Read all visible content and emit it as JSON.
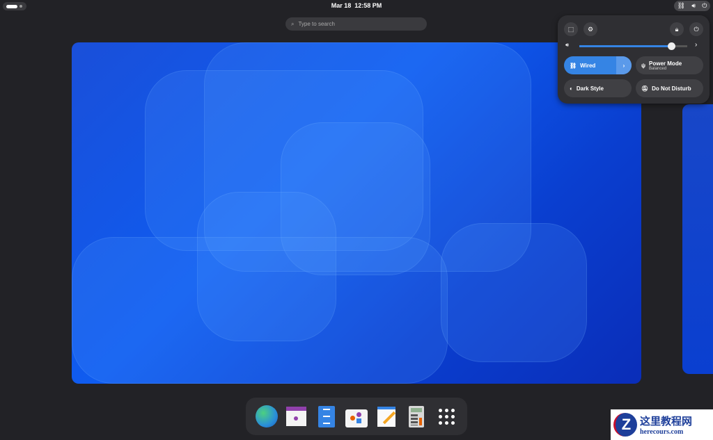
{
  "topbar": {
    "date": "Mar 18",
    "time": "12:58 PM"
  },
  "search": {
    "placeholder": "Type to search"
  },
  "quick_settings": {
    "tiles": [
      {
        "label": "Wired",
        "active": true
      },
      {
        "label": "Power Mode",
        "sublabel": "Balanced"
      },
      {
        "label": "Dark Style"
      },
      {
        "label": "Do Not Disturb"
      }
    ],
    "volume": 0.85
  },
  "dock": {
    "apps": [
      "web-browser",
      "calendar",
      "files",
      "software",
      "text-editor",
      "calculator",
      "show-apps"
    ]
  },
  "watermark": {
    "title": "这里教程网",
    "url": "herecours.com"
  },
  "colors": {
    "accent": "#3584e4",
    "panel": "#2f2f33"
  }
}
